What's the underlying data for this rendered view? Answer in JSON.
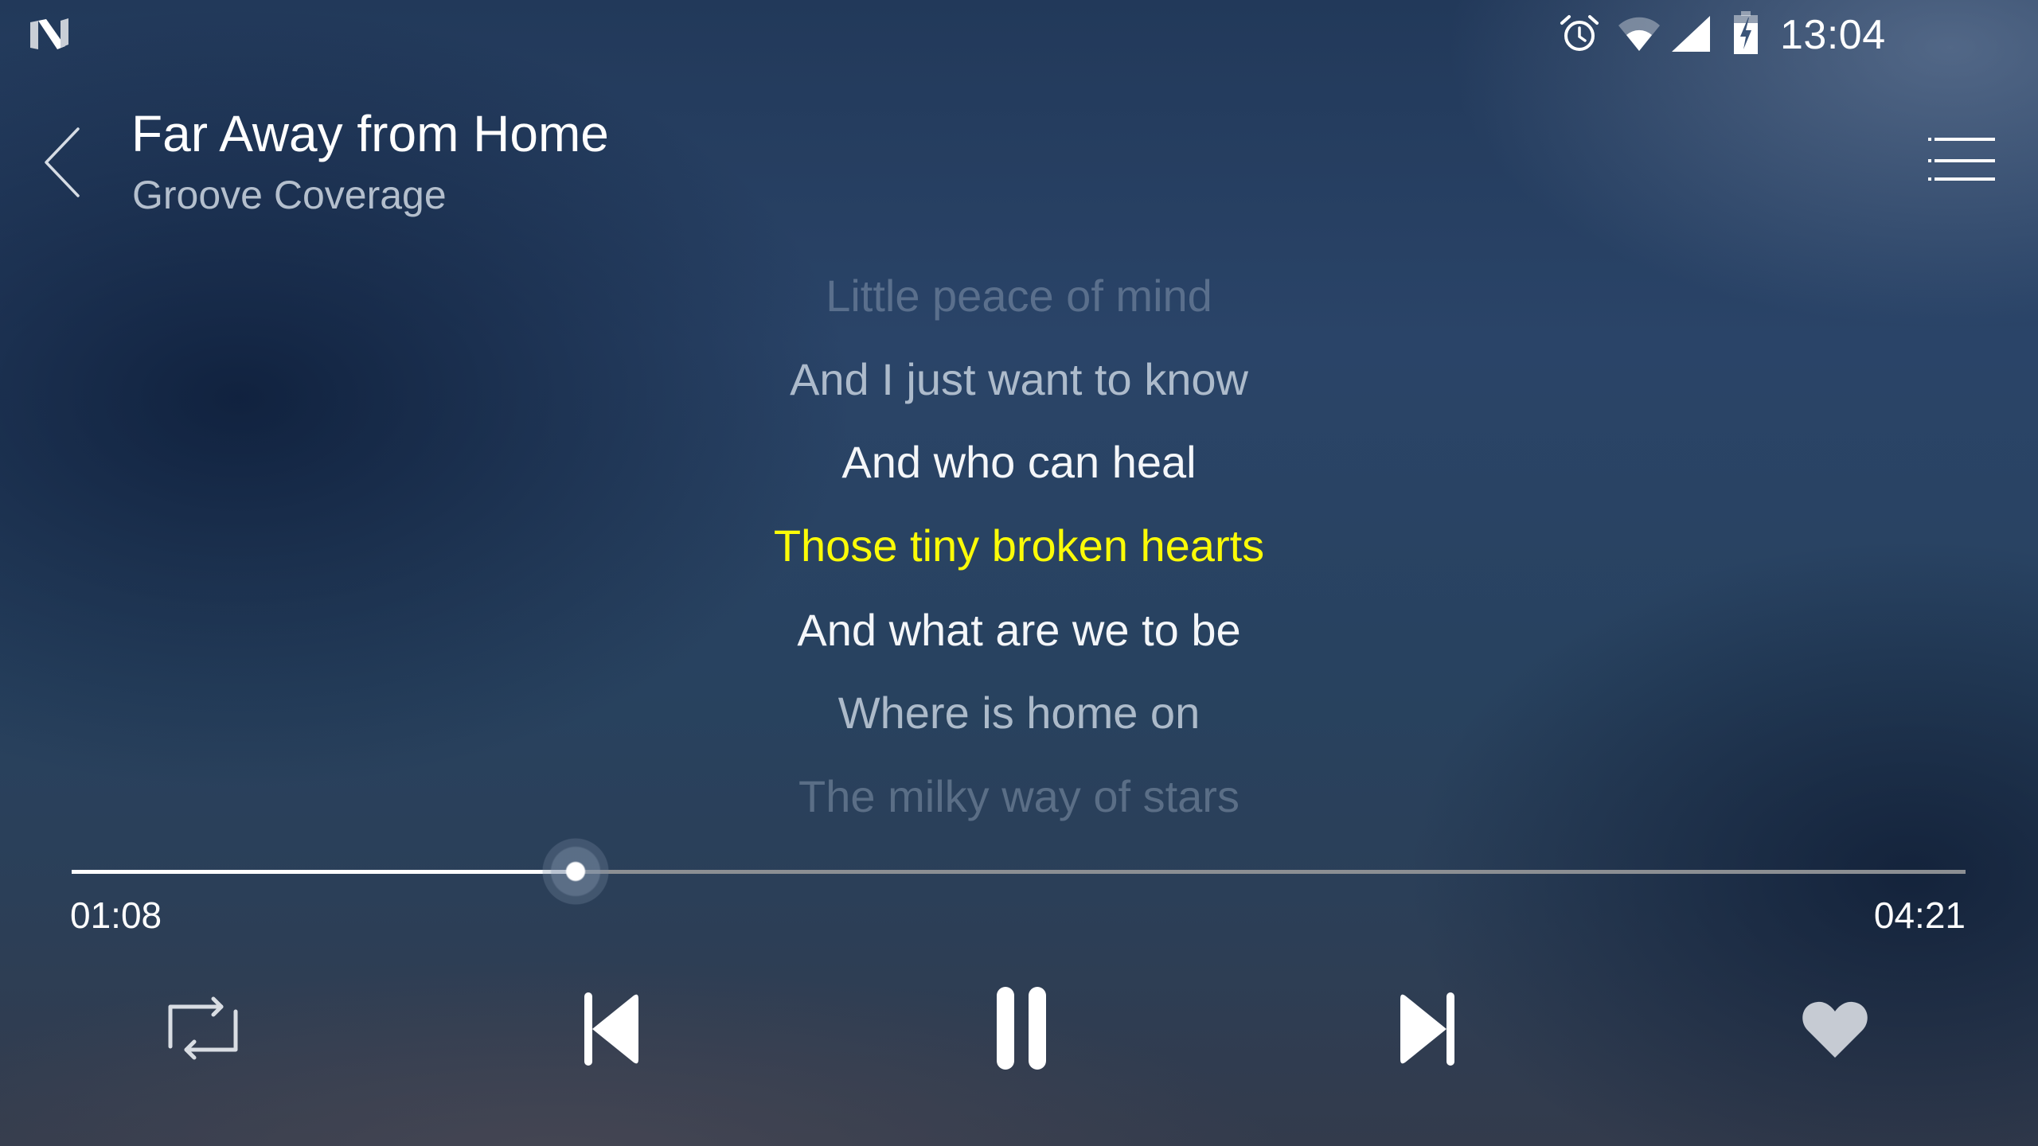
{
  "status_bar": {
    "logo_icon": "android-n-logo-icon",
    "icons": [
      "alarm-clock-icon",
      "wifi-icon",
      "cellular-signal-icon",
      "battery-charging-icon"
    ],
    "time": "13:04"
  },
  "header": {
    "back_icon": "chevron-left-icon",
    "title": "Far Away from Home",
    "artist": "Groove Coverage",
    "menu_icon": "playlist-menu-icon"
  },
  "lyrics": {
    "lines": [
      {
        "text": "Little peace of mind",
        "state": "past-faded"
      },
      {
        "text": "And I just want to know",
        "state": "past"
      },
      {
        "text": "And who can heal",
        "state": "previous"
      },
      {
        "text": "Those tiny broken hearts",
        "state": "current"
      },
      {
        "text": "And what are we to be",
        "state": "next"
      },
      {
        "text": "Where is home on",
        "state": "upcoming"
      },
      {
        "text": "The milky way of stars",
        "state": "upcoming-faded"
      }
    ],
    "current_color": "#fbfb07"
  },
  "playback": {
    "elapsed": "01:08",
    "total": "04:21",
    "progress_fraction": 0.266
  },
  "controls": {
    "repeat": {
      "icon": "repeat-icon",
      "label": "Repeat"
    },
    "previous": {
      "icon": "skip-previous-icon",
      "label": "Previous"
    },
    "play_pause": {
      "icon": "pause-icon",
      "label": "Pause",
      "state": "playing"
    },
    "next": {
      "icon": "skip-next-icon",
      "label": "Next"
    },
    "favorite": {
      "icon": "heart-icon",
      "label": "Favorite"
    }
  }
}
